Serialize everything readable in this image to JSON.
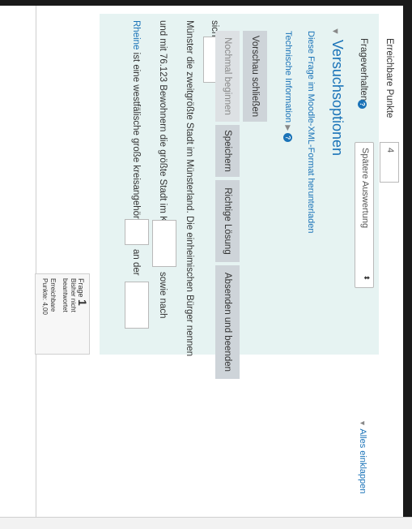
{
  "question_info": {
    "frage_label": "Frage",
    "frage_number": "1",
    "status_line1": "Bisher nicht",
    "status_line2": "beantwortet",
    "points_line1": "Erreichbare",
    "points_line2": "Punkte: 4,00"
  },
  "question_text": {
    "line1_keyword": "Rheine",
    "line1_text": " ist eine westfälische große kreisangehörige",
    "line1_after_blank": "an der",
    "line2_text": "und mit 76.123 Bewohnern die größte Stadt im Kreis",
    "line2_after_blank": "sowie nach",
    "line3_text": "Münster die zweitgrößte Stadt im Münsterland. Die einheimischen Bürger nennen",
    "line4_text": "sich"
  },
  "buttons": {
    "restart": "Nochmal beginnen",
    "save": "Speichern",
    "correct_solution": "Richtige Lösung",
    "submit_finish": "Absenden und beenden",
    "close_preview": "Vorschau schließen"
  },
  "links": {
    "technical_info": "Technische Information",
    "download_xml": "Diese Frage im Moodle-XML-Format herunterladen",
    "collapse_all": "Alles einklappen"
  },
  "attempt_options": {
    "heading": "Versuchsoptionen",
    "behaviour_label": "Frageverhalten",
    "behaviour_value": "Spätere Auswertung",
    "points_label": "Erreichbare Punkte",
    "points_value": "4"
  }
}
